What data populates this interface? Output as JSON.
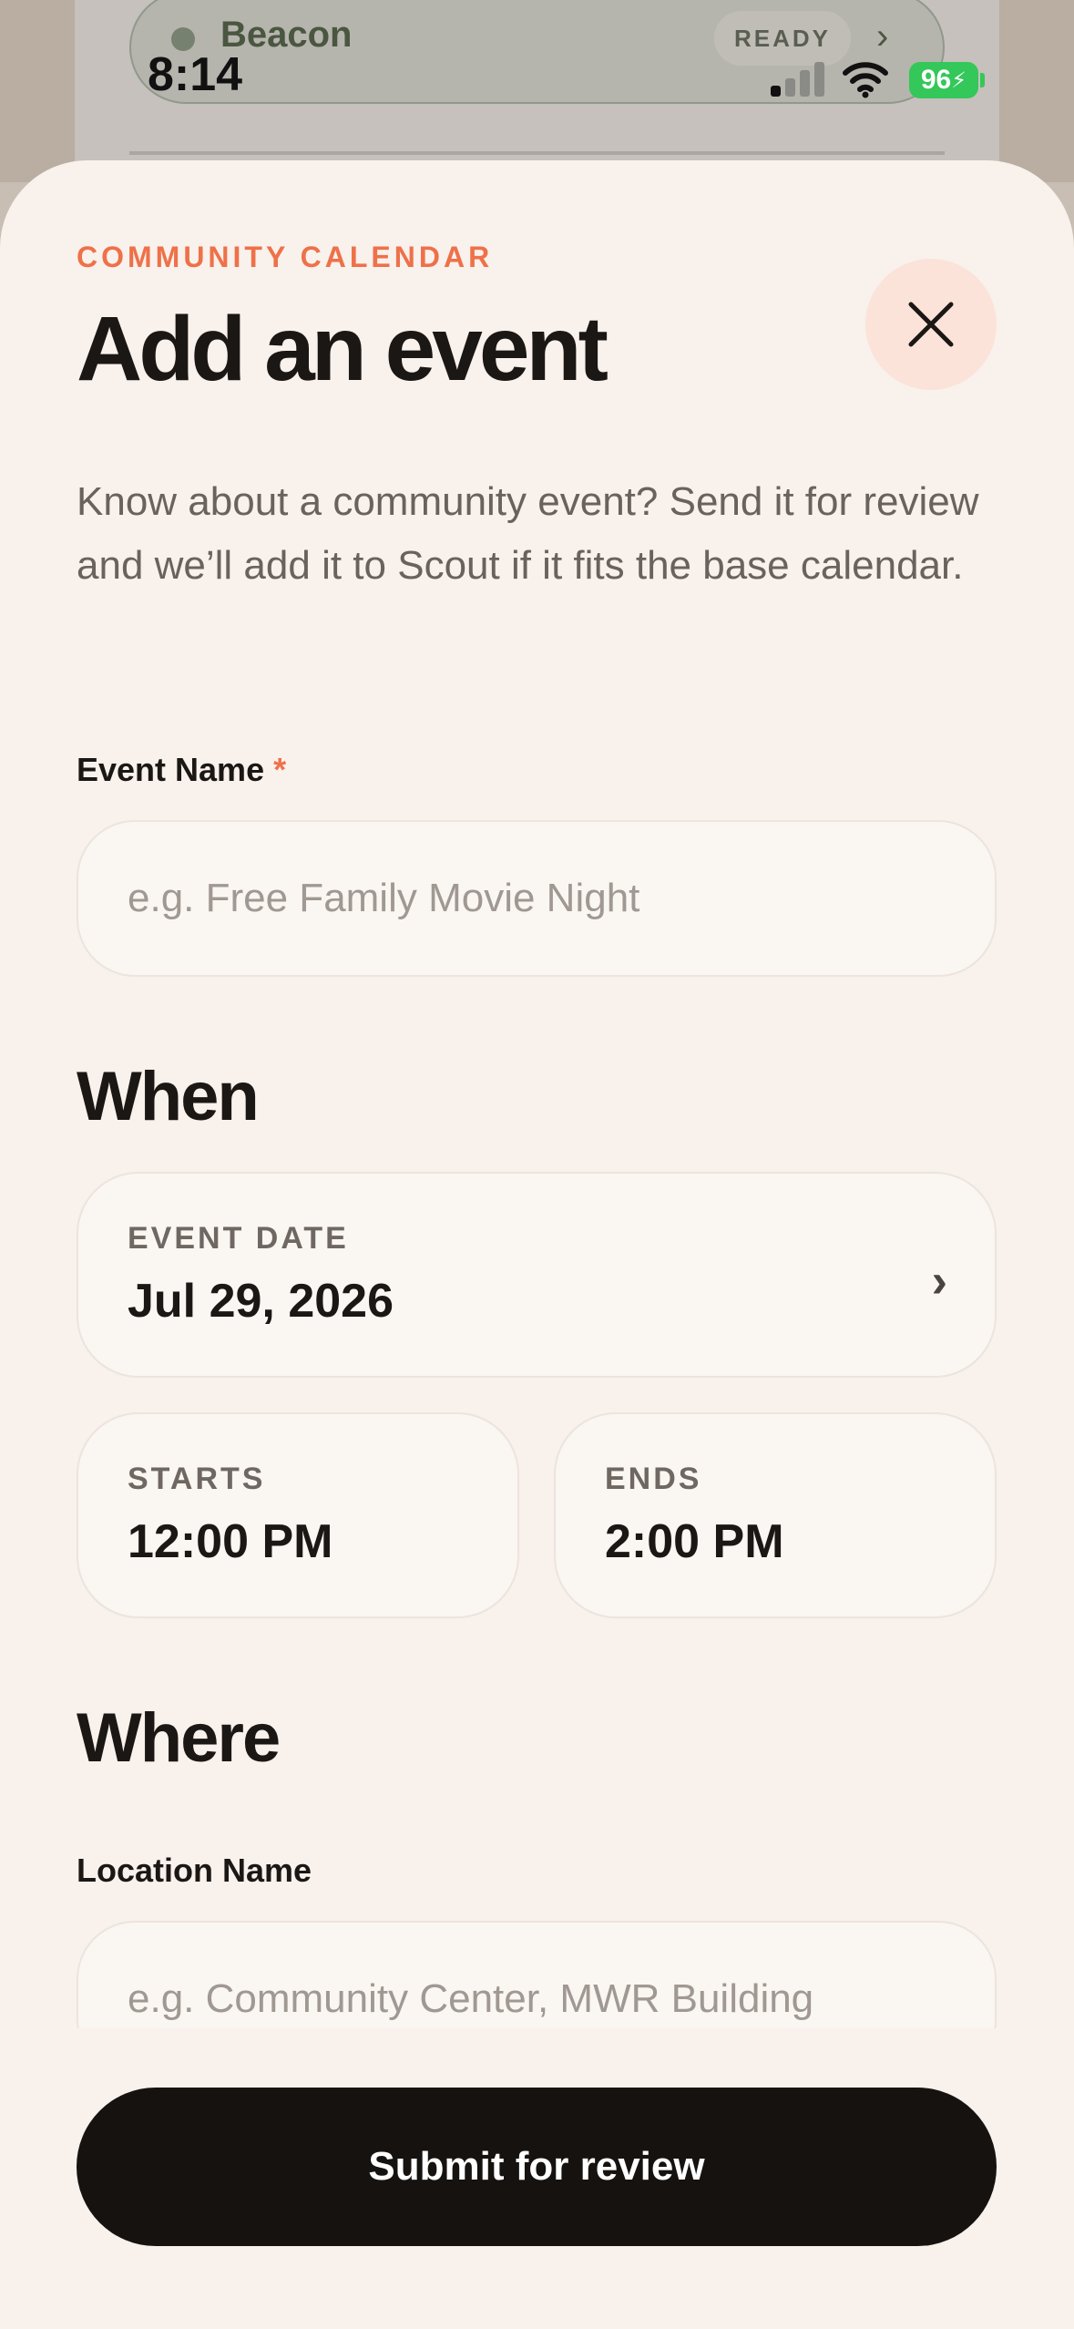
{
  "background_app": {
    "brand": "Beacon",
    "status_pill": "READY"
  },
  "status_bar": {
    "time": "8:14",
    "battery": "96"
  },
  "sheet": {
    "eyebrow": "COMMUNITY CALENDAR",
    "title": "Add an event",
    "intro": "Know about a community event? Send it for review and we’ll add it to Scout if it fits the base calendar.",
    "event_name": {
      "label": "Event Name",
      "required_mark": "*",
      "placeholder": "e.g. Free Family Movie Night"
    },
    "when": {
      "heading": "When",
      "date_label": "EVENT DATE",
      "date_value": "Jul 29, 2026",
      "starts_label": "STARTS",
      "starts_value": "12:00 PM",
      "ends_label": "ENDS",
      "ends_value": "2:00 PM"
    },
    "where": {
      "heading": "Where",
      "location_label": "Location Name",
      "location_placeholder": "e.g. Community Center, MWR Building"
    },
    "submit_label": "Submit for review"
  },
  "colors": {
    "accent": "#ee7149",
    "sheet_bg": "#f8f1ec",
    "button_bg": "#151210",
    "battery": "#34c759"
  },
  "icons": [
    "close-icon",
    "chevron-right-icon",
    "wifi-icon",
    "signal-icon",
    "battery-icon"
  ]
}
